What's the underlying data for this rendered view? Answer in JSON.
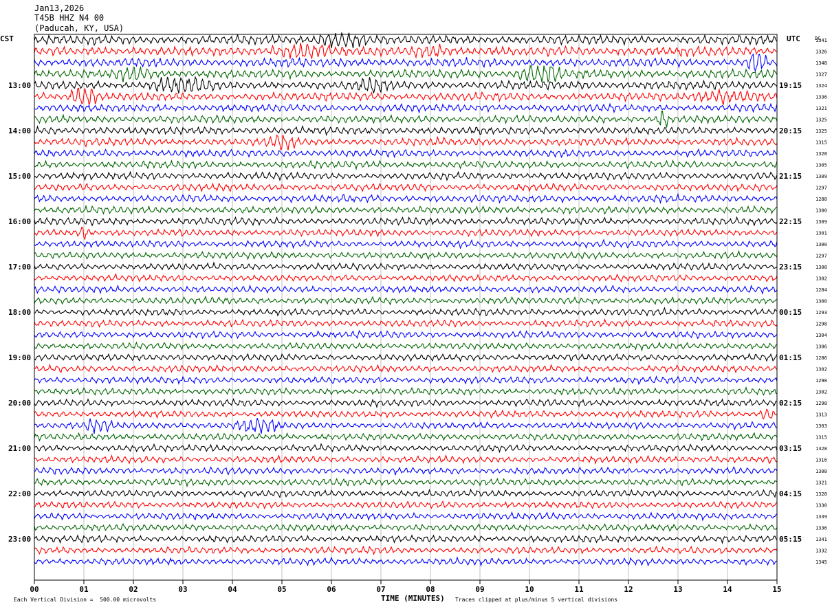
{
  "header": {
    "date": "Jan13,2026",
    "station": "T45B HHZ N4 00",
    "location": "(Paducah, KY, USA)"
  },
  "left_tz": "CST",
  "right_tz": "UTC",
  "dc_label": "DC",
  "footer": {
    "scale_note": "Each Vertical Division =  500.00 microvolts",
    "xlabel": "TIME (MINUTES)",
    "clip_note": "Traces clipped at plus/minus 5 vertical divisions"
  },
  "chart_data": {
    "type": "line",
    "title": "Jan13,2026 T45B HHZ N4 00 (Paducah, KY, USA)",
    "xlabel": "TIME (MINUTES)",
    "x_range": [
      0,
      15
    ],
    "x_ticks": [
      "00",
      "01",
      "02",
      "03",
      "04",
      "05",
      "06",
      "07",
      "08",
      "09",
      "10",
      "11",
      "12",
      "13",
      "14",
      "15"
    ],
    "minutes_per_line": 15,
    "trace_colors": [
      "#000000",
      "#ff0000",
      "#0000ff",
      "#006400"
    ],
    "grid": true,
    "left_hour_labels": [
      "13:00",
      "14:00",
      "15:00",
      "16:00",
      "17:00",
      "18:00",
      "19:00",
      "20:00",
      "21:00",
      "22:00",
      "23:00"
    ],
    "right_hour_labels": [
      "19:15",
      "20:15",
      "21:15",
      "22:15",
      "23:15",
      "00:15",
      "01:15",
      "02:15",
      "03:15",
      "04:15",
      "05:15"
    ],
    "dc_offsets": [
      1341,
      1326,
      1348,
      1327,
      1324,
      1336,
      1321,
      1325,
      1325,
      1315,
      1328,
      1305,
      1309,
      1297,
      1288,
      1300,
      1309,
      1301,
      1300,
      1297,
      1308,
      1302,
      1284,
      1300,
      1293,
      1298,
      1304,
      1306,
      1286,
      1302,
      1298,
      1302,
      1298,
      1313,
      1303,
      1315,
      1328,
      1316,
      1308,
      1321,
      1328,
      1330,
      1339,
      1336,
      1341,
      1332,
      1345
    ],
    "activity": [
      1.0,
      1.0,
      0.95,
      0.95,
      0.95,
      0.9,
      0.85,
      0.85,
      0.85,
      0.85,
      0.8,
      0.8,
      0.8,
      0.8,
      0.8,
      0.8,
      0.8,
      0.75,
      0.75,
      0.75,
      0.75,
      0.75,
      0.75,
      0.75,
      0.75,
      0.75,
      0.75,
      0.75,
      0.75,
      0.75,
      0.75,
      0.75,
      0.75,
      0.75,
      0.75,
      0.75,
      0.75,
      0.75,
      0.75,
      0.75,
      0.75,
      0.75,
      0.75,
      0.75,
      0.75,
      0.75,
      0.75
    ],
    "bursts": [
      {
        "line": 0,
        "minute": 6.2,
        "width_min": 1.2,
        "amp": 1.6
      },
      {
        "line": 1,
        "minute": 5.4,
        "width_min": 1.4,
        "amp": 1.4
      },
      {
        "line": 1,
        "minute": 8.0,
        "width_min": 1.0,
        "amp": 1.2
      },
      {
        "line": 2,
        "minute": 14.6,
        "width_min": 0.5,
        "amp": 2.8
      },
      {
        "line": 3,
        "minute": 10.2,
        "width_min": 1.1,
        "amp": 2.4
      },
      {
        "line": 3,
        "minute": 2.0,
        "width_min": 0.8,
        "amp": 1.5
      },
      {
        "line": 4,
        "minute": 3.0,
        "width_min": 1.5,
        "amp": 1.4
      },
      {
        "line": 4,
        "minute": 6.8,
        "width_min": 0.8,
        "amp": 1.3
      },
      {
        "line": 5,
        "minute": 1.0,
        "width_min": 0.7,
        "amp": 2.2
      },
      {
        "line": 5,
        "minute": 14.0,
        "width_min": 1.6,
        "amp": 1.4
      },
      {
        "line": 7,
        "minute": 12.7,
        "width_min": 0.25,
        "amp": 3.0
      },
      {
        "line": 9,
        "minute": 5.0,
        "width_min": 0.8,
        "amp": 1.5
      },
      {
        "line": 17,
        "minute": 1.0,
        "width_min": 0.3,
        "amp": 1.5
      },
      {
        "line": 34,
        "minute": 1.3,
        "width_min": 0.7,
        "amp": 1.5
      },
      {
        "line": 34,
        "minute": 4.5,
        "width_min": 1.0,
        "amp": 1.4
      },
      {
        "line": 33,
        "minute": 14.8,
        "width_min": 0.3,
        "amp": 1.5
      }
    ]
  }
}
